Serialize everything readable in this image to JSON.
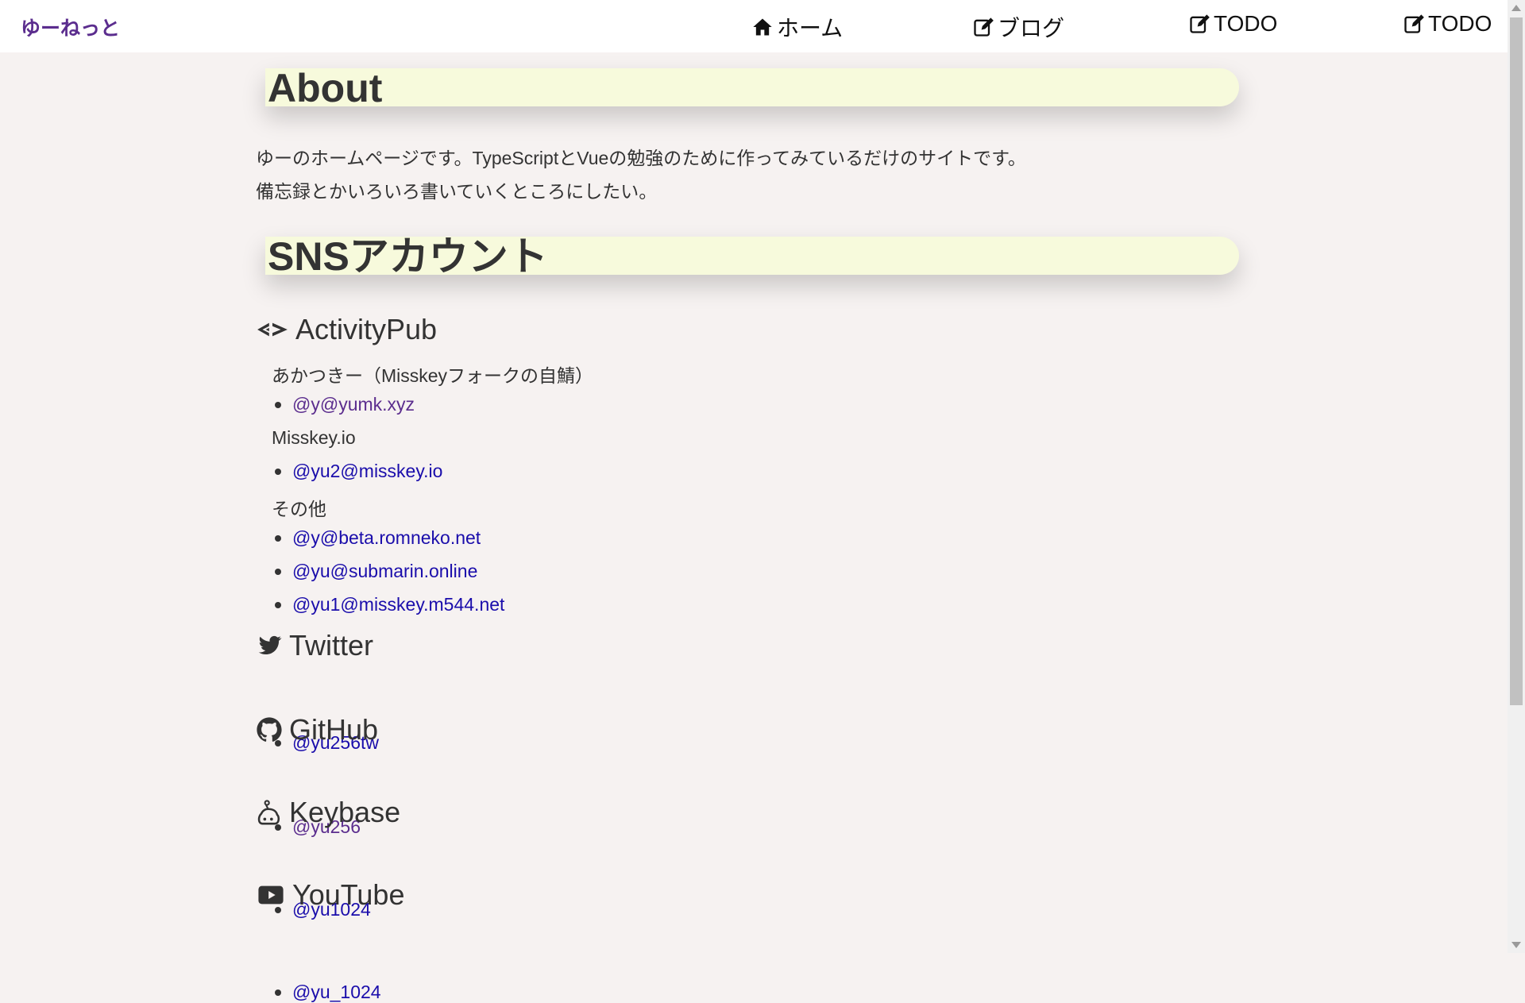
{
  "nav": {
    "brand": "ゆーねっと",
    "items": [
      {
        "label": "ホーム",
        "icon": "home-icon"
      },
      {
        "label": "ブログ",
        "icon": "edit-icon"
      },
      {
        "label": "TODO",
        "icon": "edit-icon"
      },
      {
        "label": "TODO",
        "icon": "edit-icon"
      }
    ]
  },
  "about": {
    "heading": "About",
    "lines": [
      "ゆーのホームページです。TypeScriptとVueの勉強のために作ってみているだけのサイトです。",
      "備忘録とかいろいろ書いていくところにしたい。"
    ]
  },
  "sns": {
    "heading": "SNSアカウント",
    "activitypub": {
      "title": "ActivityPub",
      "icon": "activitypub-icon",
      "groups": [
        {
          "label": "あかつきー（Misskeyフォークの自鯖）",
          "accounts": [
            "@y@yumk.xyz"
          ]
        },
        {
          "label": "Misskey.io",
          "accounts": [
            "@yu2@misskey.io"
          ]
        },
        {
          "label": "その他",
          "accounts": [
            "@y@beta.romneko.net",
            "@yu@submarin.online",
            "@yu1@misskey.m544.net"
          ]
        }
      ]
    },
    "twitter": {
      "title": "Twitter",
      "icon": "twitter-icon",
      "accounts": [
        "@yu256tw"
      ]
    },
    "github": {
      "title": "GitHub",
      "icon": "github-icon",
      "accounts": [
        "@yu256"
      ]
    },
    "keybase": {
      "title": "Keybase",
      "icon": "keybase-icon",
      "accounts": [
        "@yu1024"
      ]
    },
    "youtube": {
      "title": "YouTube",
      "icon": "youtube-icon",
      "accounts": [
        "@yu_1024"
      ]
    }
  },
  "colors": {
    "background": "#f6f2f1",
    "heading_bg": "#f7fadc",
    "link": "#1a0dab",
    "visited_link": "#5b2d8e",
    "brand": "#5b2d8e"
  }
}
